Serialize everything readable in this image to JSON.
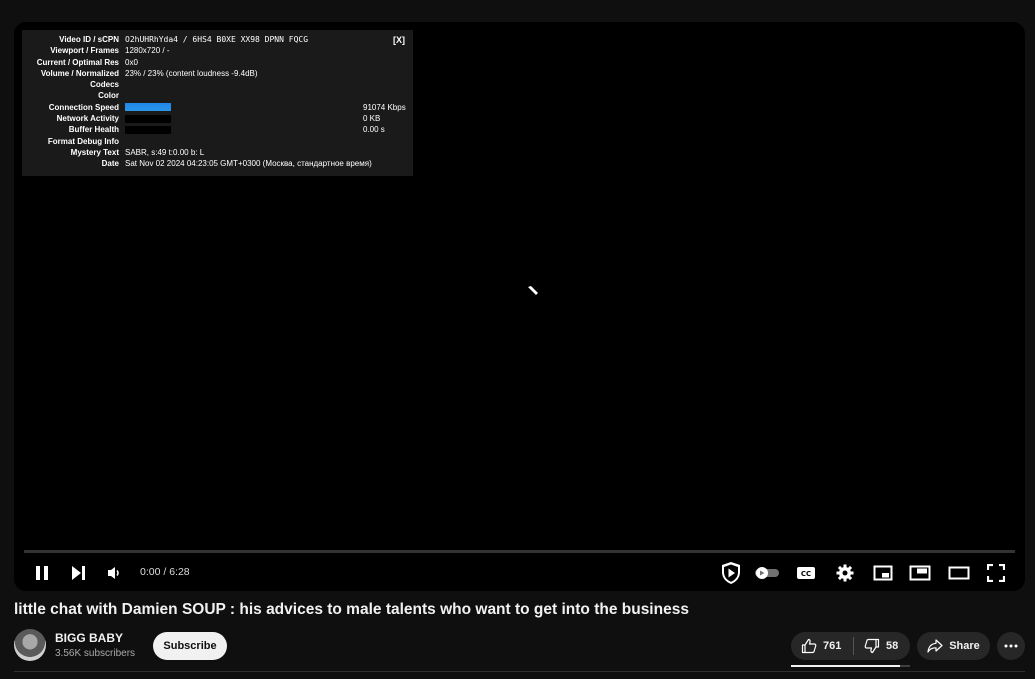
{
  "nerd_stats": {
    "close_label": "[X]",
    "rows": [
      {
        "label": "Video ID / sCPN",
        "value": "O2hUHRhYda4 / 6HS4 B0XE XX98 DPNN FQCG"
      },
      {
        "label": "Viewport / Frames",
        "value": "1280x720 / -"
      },
      {
        "label": "Current / Optimal Res",
        "value": "0x0"
      },
      {
        "label": "Volume / Normalized",
        "value": "23% / 23% (content loudness -9.4dB)"
      },
      {
        "label": "Codecs",
        "value": ""
      },
      {
        "label": "Color",
        "value": ""
      },
      {
        "label": "Connection Speed",
        "value": "91074 Kbps"
      },
      {
        "label": "Network Activity",
        "value": "0 KB"
      },
      {
        "label": "Buffer Health",
        "value": "0.00 s"
      },
      {
        "label": "Format Debug Info",
        "value": ""
      },
      {
        "label": "Mystery Text",
        "value": "SABR, s:49 t:0.00 b: L"
      },
      {
        "label": "Date",
        "value": "Sat Nov 02 2024 04:23:05 GMT+0300 (Москва, стандартное время)"
      }
    ]
  },
  "player": {
    "time": "0:00 / 6:28",
    "progress_fraction": 0.0
  },
  "video": {
    "title": "little chat with Damien SOUP : his advices to male talents who want to get into the business",
    "channel_name": "BIGG BABY",
    "subscribers": "3.56K subscribers",
    "subscribe_label": "Subscribe",
    "likes": "761",
    "dislikes": "58",
    "share_label": "Share",
    "like_ratio": 0.92
  },
  "icons": {
    "pause": "pause-icon",
    "next": "next-icon",
    "volume": "volume-icon",
    "shield": "shield-play-icon",
    "autoplay": "autoplay-toggle-icon",
    "cc": "captions-icon",
    "settings": "gear-icon",
    "miniplayer": "miniplayer-icon",
    "pip": "picture-in-picture-icon",
    "theater": "theater-mode-icon",
    "fullscreen": "fullscreen-icon",
    "like": "thumbs-up-icon",
    "dislike": "thumbs-down-icon",
    "share": "share-arrow-icon",
    "more": "more-dots-icon"
  },
  "colors": {
    "background": "#0f0f0f",
    "player": "#000000",
    "connection_graph": "#1e88e5"
  }
}
